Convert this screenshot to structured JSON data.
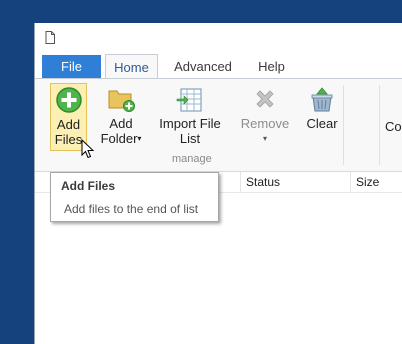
{
  "tabs": {
    "file": "File",
    "home": "Home",
    "advanced": "Advanced",
    "help": "Help"
  },
  "ribbon": {
    "add_files": {
      "line1": "Add",
      "line2": "Files"
    },
    "add_folder": {
      "line1": "Add",
      "line2": "Folder"
    },
    "import": {
      "line1": "Import File",
      "line2": "List"
    },
    "remove": {
      "line1": "Remove"
    },
    "clear": {
      "line1": "Clear"
    },
    "partial": "Co",
    "group_label": "manage"
  },
  "table": {
    "columns": [
      "Status",
      "Size"
    ]
  },
  "tooltip": {
    "title": "Add Files",
    "description": "Add files to the end of list"
  },
  "colors": {
    "file_tab": "#2f7fd7",
    "desktop": "#15427c",
    "hover": "#fcefb3"
  },
  "icons": [
    "document-icon",
    "add-files-icon",
    "add-folder-icon",
    "import-list-icon",
    "remove-icon",
    "clear-icon",
    "mouse-cursor-icon"
  ]
}
